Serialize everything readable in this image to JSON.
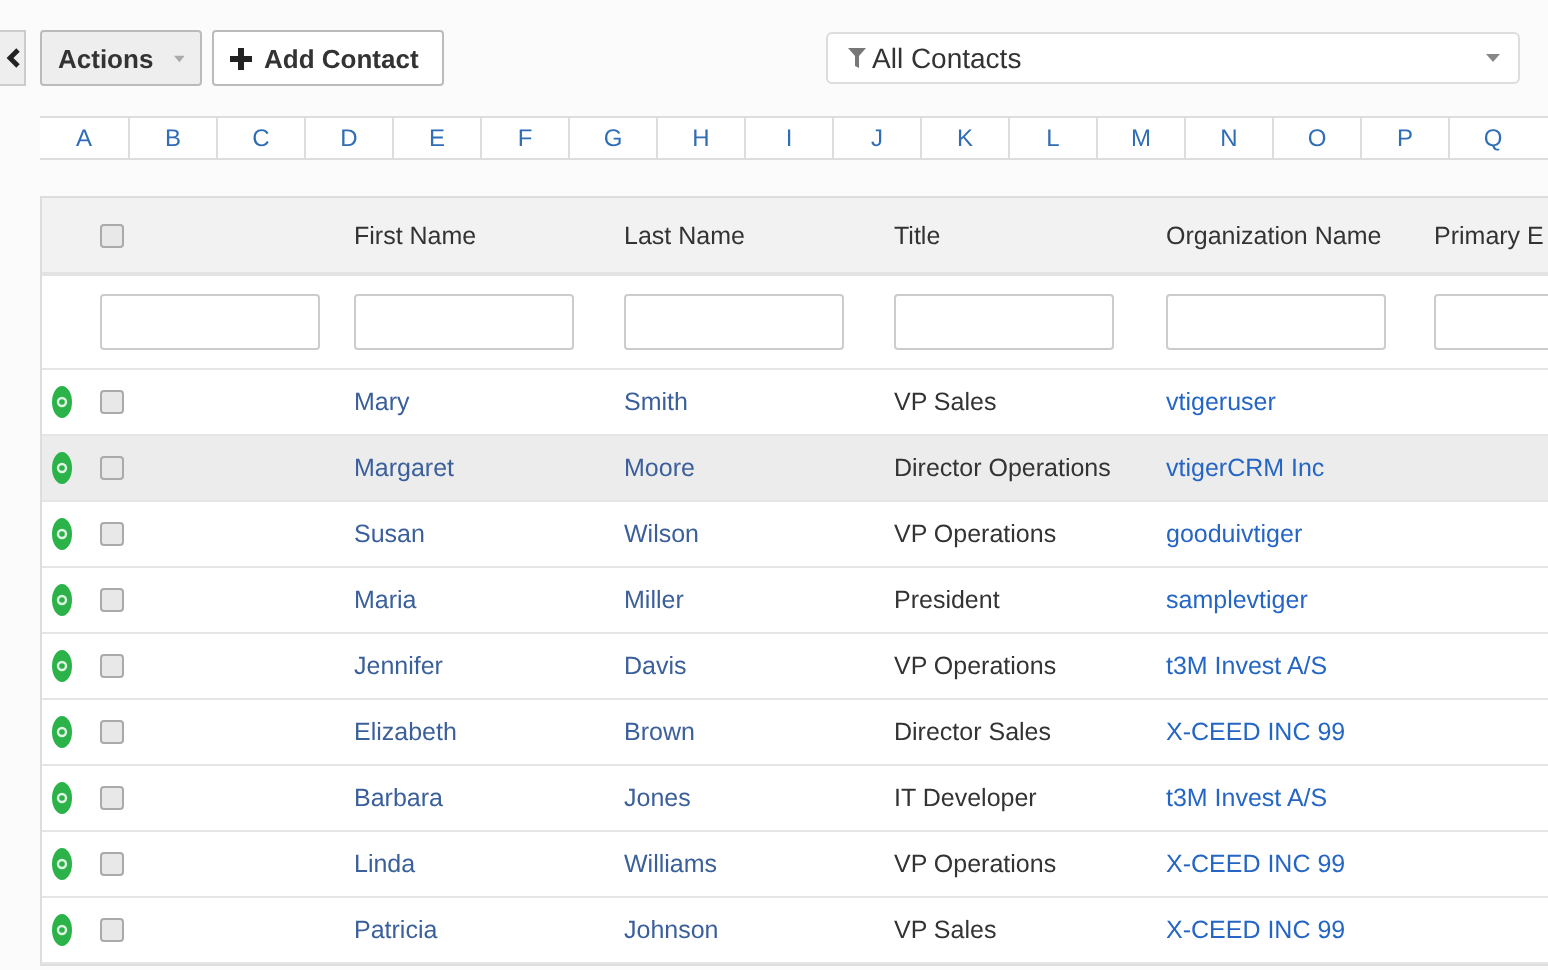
{
  "toolbar": {
    "actions_button": "Actions",
    "add_button": "Add Contact",
    "filter": "All Contacts"
  },
  "alphabet": [
    "A",
    "B",
    "C",
    "D",
    "E",
    "F",
    "G",
    "H",
    "I",
    "J",
    "K",
    "L",
    "M",
    "N",
    "O",
    "P",
    "Q"
  ],
  "table": {
    "select_all_checked": false,
    "columns": [
      "First Name",
      "Last Name",
      "Title",
      "Organization Name",
      "Primary E"
    ],
    "rows": [
      {
        "first_name": "Mary",
        "last_name": "Smith",
        "title": "VP Sales",
        "organization": "vtigeruser",
        "checked": false,
        "hovered": false
      },
      {
        "first_name": "Margaret",
        "last_name": "Moore",
        "title": "Director Operations",
        "organization": "vtigerCRM Inc",
        "checked": false,
        "hovered": true
      },
      {
        "first_name": "Susan",
        "last_name": "Wilson",
        "title": "VP Operations",
        "organization": "gooduivtiger",
        "checked": false,
        "hovered": false
      },
      {
        "first_name": "Maria",
        "last_name": "Miller",
        "title": "President",
        "organization": "samplevtiger",
        "checked": false,
        "hovered": false
      },
      {
        "first_name": "Jennifer",
        "last_name": "Davis",
        "title": "VP Operations",
        "organization": "t3M Invest A/S",
        "checked": false,
        "hovered": false
      },
      {
        "first_name": "Elizabeth",
        "last_name": "Brown",
        "title": "Director Sales",
        "organization": "X-CEED INC 99",
        "checked": false,
        "hovered": false
      },
      {
        "first_name": "Barbara",
        "last_name": "Jones",
        "title": "IT Developer",
        "organization": "t3M Invest A/S",
        "checked": false,
        "hovered": false
      },
      {
        "first_name": "Linda",
        "last_name": "Williams",
        "title": "VP Operations",
        "organization": "X-CEED INC 99",
        "checked": false,
        "hovered": false
      },
      {
        "first_name": "Patricia",
        "last_name": "Johnson",
        "title": "VP Sales",
        "organization": "X-CEED INC 99",
        "checked": false,
        "hovered": false
      }
    ]
  }
}
